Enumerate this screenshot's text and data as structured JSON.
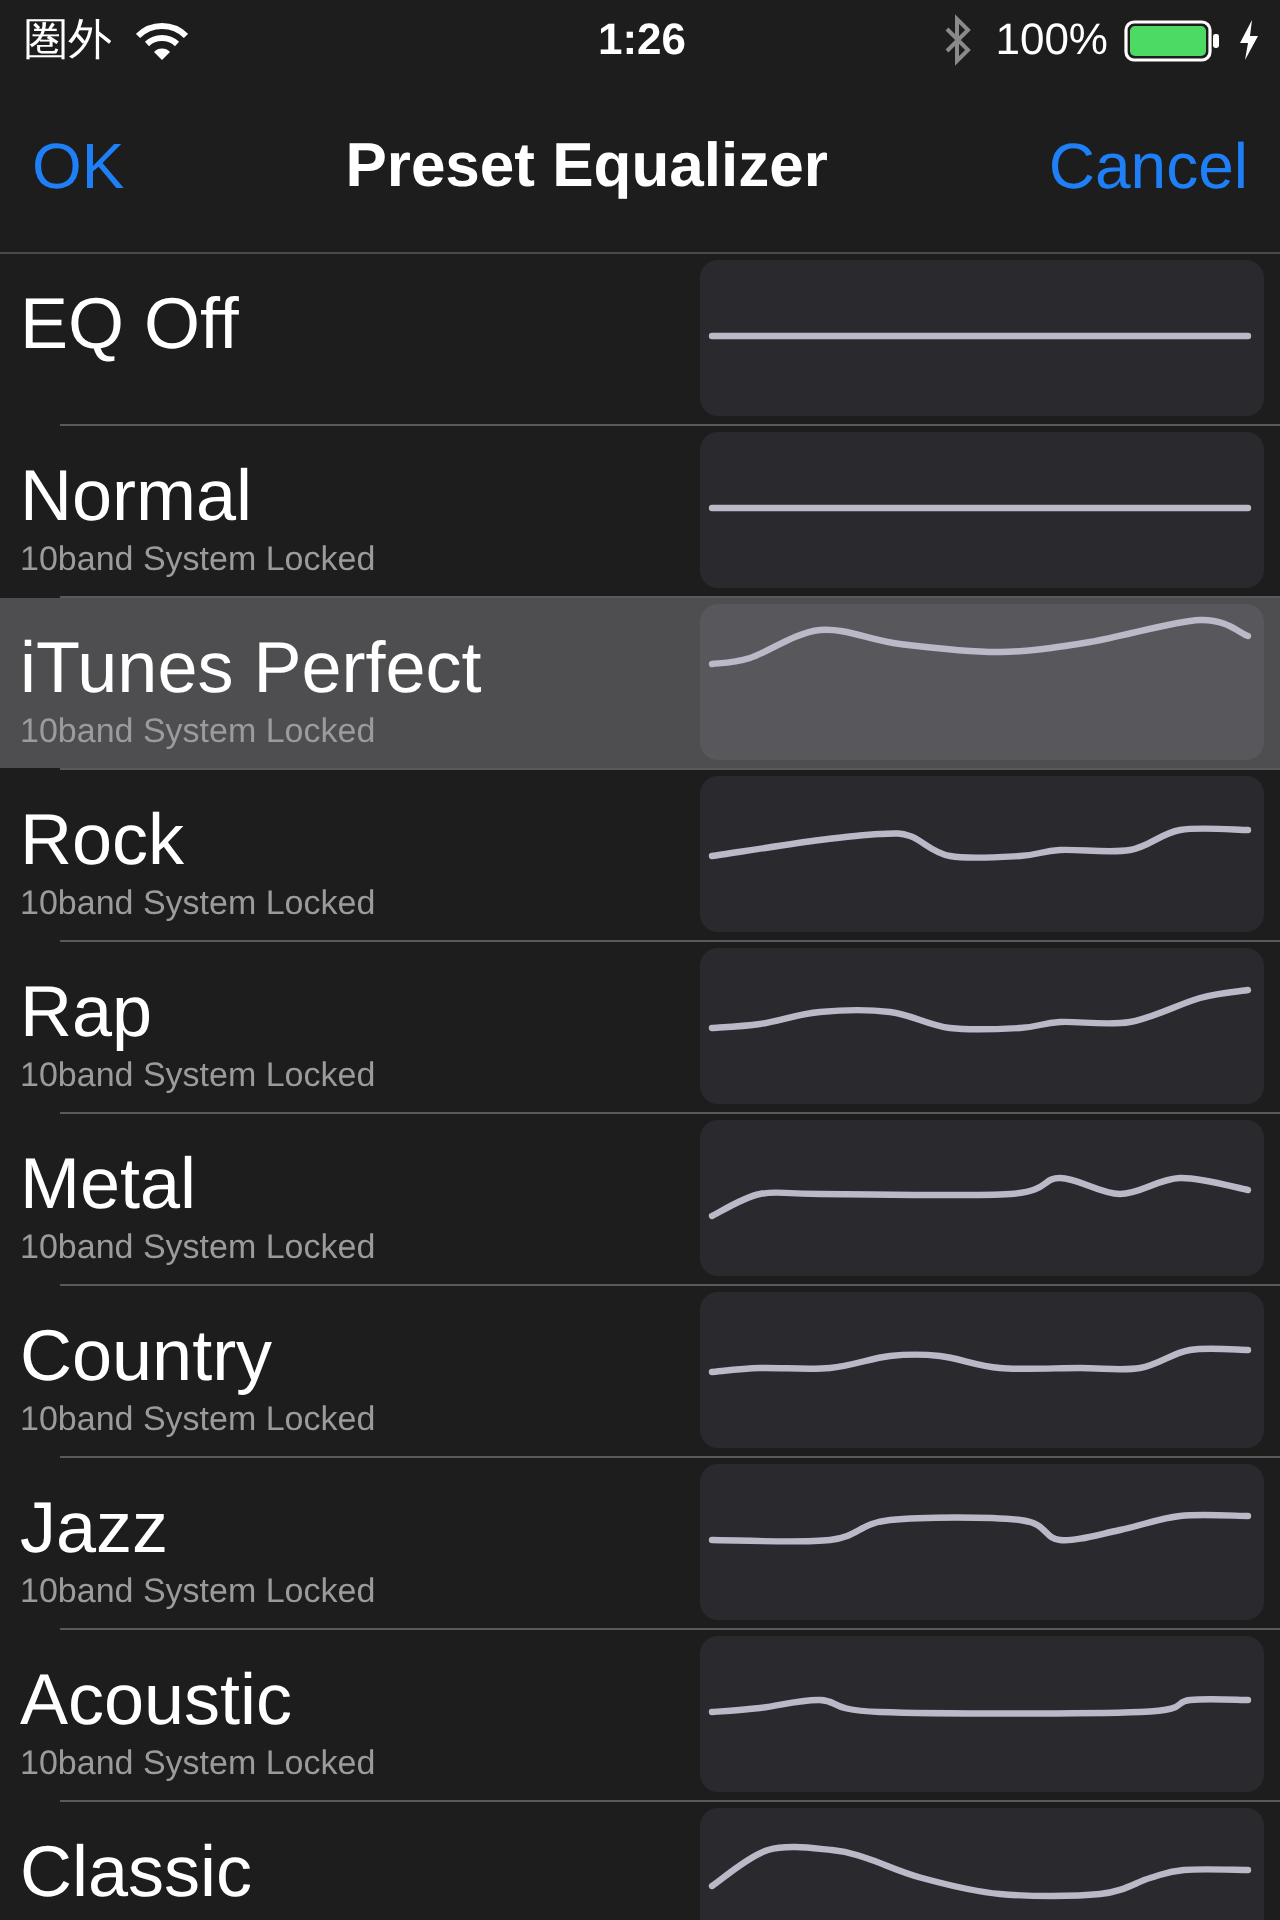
{
  "status_bar": {
    "carrier": "圏外",
    "time": "1:26",
    "battery_percent": "100%"
  },
  "nav_bar": {
    "left_button": "OK",
    "title": "Preset Equalizer",
    "right_button": "Cancel"
  },
  "presets": [
    {
      "name": "EQ Off",
      "selected": false
    },
    {
      "name": "Normal",
      "subtitle": "10band System Locked",
      "selected": false
    },
    {
      "name": "iTunes Perfect",
      "subtitle": "10band System Locked",
      "selected": true
    },
    {
      "name": "Rock",
      "subtitle": "10band System Locked",
      "selected": false
    },
    {
      "name": "Rap",
      "subtitle": "10band System Locked",
      "selected": false
    },
    {
      "name": "Metal",
      "subtitle": "10band System Locked",
      "selected": false
    },
    {
      "name": "Country",
      "subtitle": "10band System Locked",
      "selected": false
    },
    {
      "name": "Jazz",
      "subtitle": "10band System Locked",
      "selected": false
    },
    {
      "name": "Acoustic",
      "subtitle": "10band System Locked",
      "selected": false
    },
    {
      "name": "Classic",
      "selected": false
    }
  ]
}
